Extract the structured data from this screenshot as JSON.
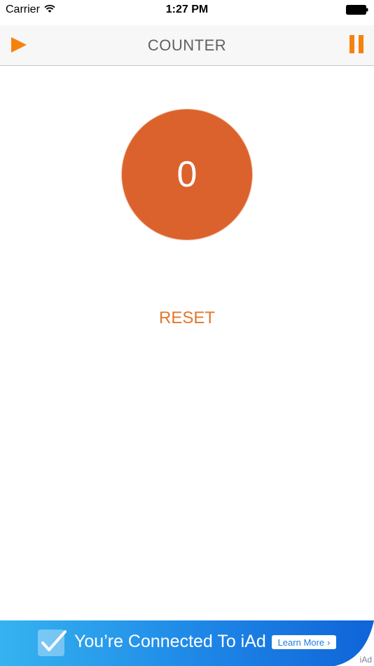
{
  "status_bar": {
    "carrier": "Carrier",
    "time": "1:27 PM"
  },
  "nav_bar": {
    "title": "COUNTER",
    "left_icon": "play-icon",
    "right_icon": "pause-icon"
  },
  "counter": {
    "value": "0"
  },
  "reset": {
    "label": "RESET"
  },
  "ad": {
    "text": "You’re Connected To iAd",
    "button_label": "Learn More",
    "badge": "iAd"
  },
  "colors": {
    "accent": "#f5820f",
    "counter_fill": "#dc622d",
    "reset_text": "#e2772c",
    "title_text": "#5f6063",
    "ad_start": "#35b3f0",
    "ad_end": "#0f64d8"
  }
}
